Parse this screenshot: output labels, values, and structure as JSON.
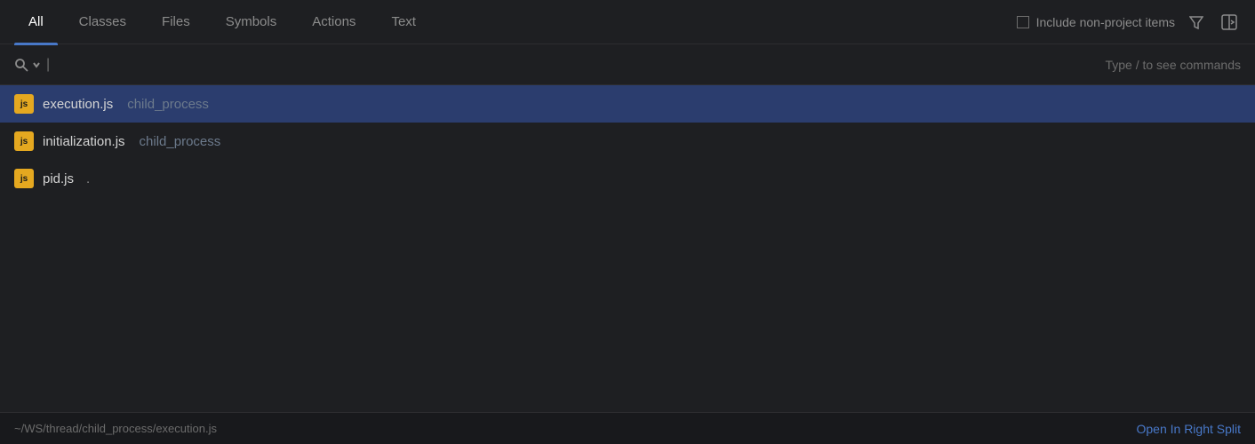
{
  "tabs": {
    "items": [
      {
        "label": "All",
        "active": true
      },
      {
        "label": "Classes",
        "active": false
      },
      {
        "label": "Files",
        "active": false
      },
      {
        "label": "Symbols",
        "active": false
      },
      {
        "label": "Actions",
        "active": false
      },
      {
        "label": "Text",
        "active": false
      }
    ]
  },
  "options": {
    "include_non_project": "Include non-project items"
  },
  "search": {
    "placeholder": "",
    "hint": "Type / to see commands"
  },
  "results": {
    "items": [
      {
        "name": "execution.js",
        "path": "child_process",
        "dot": "",
        "selected": true
      },
      {
        "name": "initialization.js",
        "path": "child_process",
        "dot": "",
        "selected": false
      },
      {
        "name": "pid.js",
        "path": ".",
        "dot": "",
        "selected": false
      }
    ]
  },
  "status": {
    "path": "~/WS/thread/child_process/execution.js",
    "open_right_split": "Open In Right Split"
  },
  "colors": {
    "active_tab_underline": "#4878c8",
    "selected_row": "#2b3d6e",
    "file_icon_bg": "#e5a820",
    "open_right_split_text": "#4878c8"
  }
}
